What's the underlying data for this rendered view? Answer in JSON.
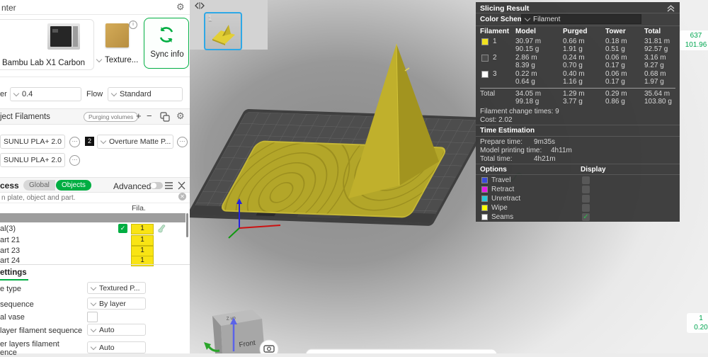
{
  "colors": {
    "accent_green": "#00ae42",
    "thumb_border_blue": "#2ea8e6",
    "filament_yellow": "#f0e11e",
    "filament_dark": "#4a4a4a",
    "filament_white": "#ffffff",
    "slider_green": "#00a650"
  },
  "left": {
    "header": {
      "title": "nter"
    },
    "printer_card": {
      "name": "Bambu Lab X1 Carbon"
    },
    "plate_card": {
      "label": "Texture..."
    },
    "sync_button": {
      "label": "Sync info"
    },
    "nozzle_row": {
      "label": "er",
      "value": "0.4",
      "flow_label": "Flow",
      "flow_value": "Standard"
    },
    "filaments_section": {
      "title": "ject Filaments",
      "purging_button": "Purging volumes",
      "add": "+",
      "remove": "−"
    },
    "filaments": [
      {
        "index": "",
        "name": "SUNLU PLA+ 2.0"
      },
      {
        "index": "2",
        "name": "Overture Matte P..."
      },
      {
        "index": "",
        "name": "SUNLU PLA+ 2.0"
      }
    ],
    "process_row": {
      "title": "cess",
      "global_label": "Global",
      "objects_label": "Objects",
      "advanced_label": "Advanced"
    },
    "search": {
      "placeholder": "n plate, object and part."
    },
    "object_table": {
      "fila_header": "Fila.",
      "rows": [
        {
          "name": "al(3)",
          "fila": "1"
        },
        {
          "name": "art 21",
          "fila": "1"
        },
        {
          "name": "art 23",
          "fila": "1"
        },
        {
          "name": "art 24",
          "fila": "1"
        }
      ]
    },
    "settings_tab": "ettings",
    "settings_rows": [
      {
        "label": "e type",
        "value": "Textured P..."
      },
      {
        "label": "sequence",
        "value": "By layer"
      },
      {
        "label": "al vase",
        "value": ""
      },
      {
        "label": "layer filament sequence",
        "value": "Auto"
      },
      {
        "label": "er layers filament",
        "label2": "ence",
        "value": "Auto"
      }
    ]
  },
  "viewport": {
    "plate_thumbnail": {
      "number": "1"
    },
    "nav_cube": {
      "front_label": "Front",
      "top_label": "Z up"
    },
    "layer_slider": {
      "top_layer": "637",
      "top_height": "101.96",
      "bottom_layer": "1",
      "bottom_height": "0.20"
    }
  },
  "slicing": {
    "title": "Slicing Result",
    "color_scheme_label": "Color Scheme",
    "color_scheme_value": "Filament",
    "table": {
      "headers": [
        "Filament",
        "Model",
        "Purged",
        "Tower",
        "Total"
      ],
      "rows": [
        {
          "id": "1",
          "color": "#f0e11e",
          "model_m": "30.97 m",
          "model_g": "90.15 g",
          "purged_m": "0.66 m",
          "purged_g": "1.91 g",
          "tower_m": "0.18 m",
          "tower_g": "0.51 g",
          "total_m": "31.81 m",
          "total_g": "92.57 g"
        },
        {
          "id": "2",
          "color": "#4a4a4a",
          "model_m": "2.86 m",
          "model_g": "8.39 g",
          "purged_m": "0.24 m",
          "purged_g": "0.70 g",
          "tower_m": "0.06 m",
          "tower_g": "0.17 g",
          "total_m": "3.16 m",
          "total_g": "9.27 g"
        },
        {
          "id": "3",
          "color": "#ffffff",
          "model_m": "0.22 m",
          "model_g": "0.64 g",
          "purged_m": "0.40 m",
          "purged_g": "1.16 g",
          "tower_m": "0.06 m",
          "tower_g": "0.17 g",
          "total_m": "0.68 m",
          "total_g": "1.97 g"
        }
      ],
      "total": {
        "label": "Total",
        "model_m": "34.05 m",
        "model_g": "99.18 g",
        "purged_m": "1.29 m",
        "purged_g": "3.77 g",
        "tower_m": "0.29 m",
        "tower_g": "0.86 g",
        "total_m": "35.64 m",
        "total_g": "103.80 g"
      }
    },
    "filament_change_times": "Filament change times:  9",
    "cost": "Cost:  2.02",
    "time_estimation": {
      "title": "Time Estimation",
      "prepare_label": "Prepare time:",
      "prepare_value": "9m35s",
      "model_label": "Model printing time:",
      "model_value": "4h11m",
      "total_label": "Total time:",
      "total_value": "4h21m"
    },
    "options": {
      "title": "Options",
      "display_header": "Display",
      "rows": [
        {
          "label": "Travel",
          "color": "#3b4bd8",
          "checked": false
        },
        {
          "label": "Retract",
          "color": "#e619e6",
          "checked": false
        },
        {
          "label": "Unretract",
          "color": "#28c8d7",
          "checked": false
        },
        {
          "label": "Wipe",
          "color": "#ffff00",
          "checked": false
        },
        {
          "label": "Seams",
          "color": "#ffffff",
          "checked": true
        }
      ]
    }
  }
}
